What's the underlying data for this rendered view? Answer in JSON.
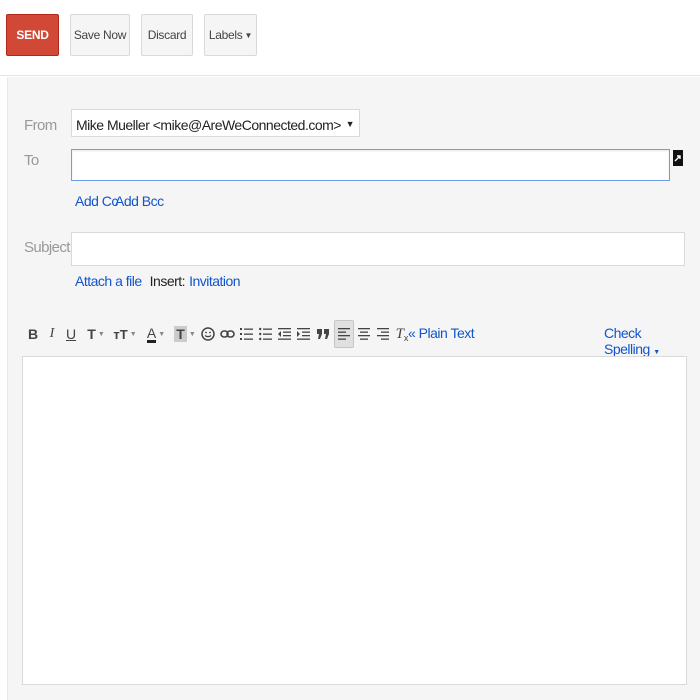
{
  "toolbar": {
    "send_label": "SEND",
    "save_now_label": "Save Now",
    "discard_label": "Discard",
    "labels_label": "Labels"
  },
  "compose": {
    "from_label": "From",
    "from_value": "Mike Mueller <mike@AreWeConnected.com>",
    "to_label": "To",
    "to_value": "",
    "add_cc": "Add Cc",
    "add_bcc": "Add Bcc",
    "subject_label": "Subject",
    "subject_value": "",
    "attach_file": "Attach a file",
    "insert_label": "Insert:",
    "invitation": "Invitation",
    "body_value": ""
  },
  "format_bar": {
    "bold": "B",
    "italic": "I",
    "underline": "U",
    "font": "T",
    "size": "тT",
    "text_color": "A",
    "highlight": "T",
    "remove_format": "T",
    "plain_text": "« Plain Text",
    "check_spelling": "Check Spelling"
  },
  "colors": {
    "send": "#d14836",
    "link": "#1155cc",
    "compose_bg": "#f5f5f5",
    "focus_border": "#6d9eeb"
  },
  "icons": [
    "emoji-icon",
    "link-icon",
    "numbered-list-icon",
    "bulleted-list-icon",
    "indent-less-icon",
    "indent-more-icon",
    "quote-icon",
    "align-left-icon",
    "align-center-icon",
    "align-right-icon",
    "remove-formatting-icon"
  ]
}
